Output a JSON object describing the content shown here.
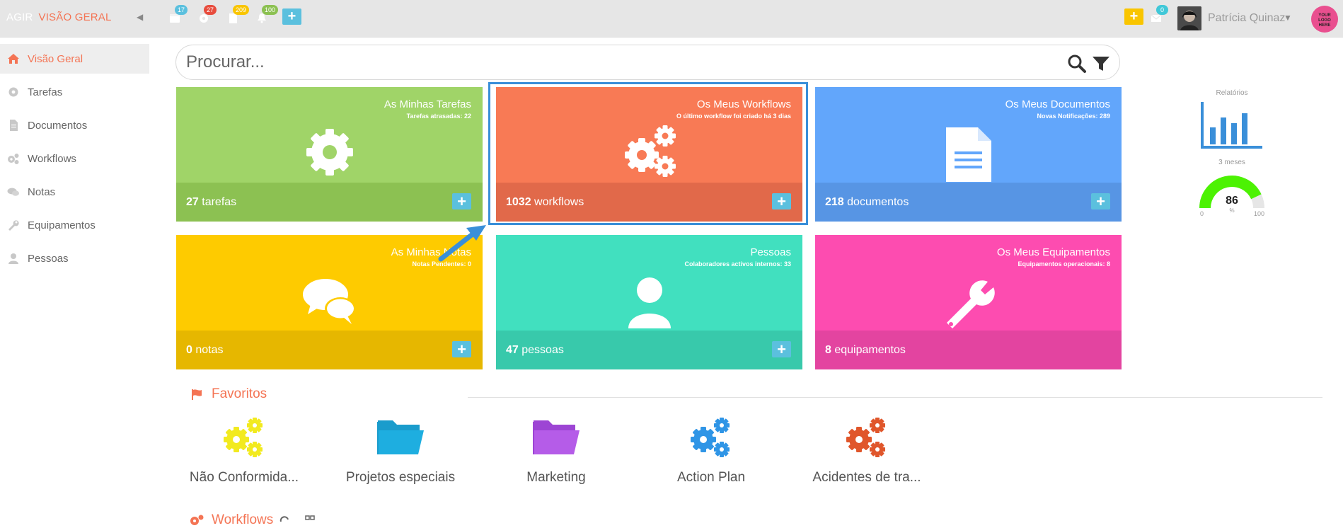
{
  "topbar": {
    "brand": "AGIR",
    "section": "VISÃO GERAL",
    "badges": {
      "calendar": "17",
      "gear": "27",
      "doc": "209",
      "bell": "100",
      "mail": "0"
    },
    "user_name": "Patrícia Quinaz",
    "logo_text_1": "YOUR",
    "logo_text_2": "LOGO",
    "logo_text_3": "HERE",
    "colors": {
      "badge_blue": "#5bc0de",
      "badge_red": "#e84c3d",
      "badge_yellow": "#f9c500",
      "badge_green": "#8cc152"
    }
  },
  "sidebar": {
    "items": [
      {
        "label": "Visão Geral",
        "icon": "home-icon",
        "active": true
      },
      {
        "label": "Tarefas",
        "icon": "gear-icon"
      },
      {
        "label": "Documentos",
        "icon": "document-icon"
      },
      {
        "label": "Workflows",
        "icon": "gears-icon"
      },
      {
        "label": "Notas",
        "icon": "comments-icon"
      },
      {
        "label": "Equipamentos",
        "icon": "wrench-icon"
      },
      {
        "label": "Pessoas",
        "icon": "user-icon"
      }
    ]
  },
  "search": {
    "placeholder": "Procurar..."
  },
  "tiles": [
    {
      "title": "As Minhas Tarefas",
      "sub": "Tarefas atrasadas: 22",
      "count": "27",
      "unit": "tarefas",
      "icon": "gear-icon",
      "color": "#a0d468",
      "footer_color": "#8cc152"
    },
    {
      "title": "Os Meus Workflows",
      "sub": "O último workflow foi criado há 3 dias",
      "count": "1032",
      "unit": "workflows",
      "icon": "gears-icon",
      "color": "#f87a55",
      "footer_color": "#e1694a"
    },
    {
      "title": "Os Meus Documentos",
      "sub": "Novas Notificações: 289",
      "count": "218",
      "unit": "documentos",
      "icon": "document-icon",
      "color": "#62a6fb",
      "footer_color": "#5795e4"
    },
    {
      "title": "As Minhas Notas",
      "sub": "Notas Pendentes: 0",
      "count": "0",
      "unit": "notas",
      "icon": "comments-icon",
      "color": "#fecb00",
      "footer_color": "#e6b700"
    },
    {
      "title": "Pessoas",
      "sub": "Colaboradores activos internos: 33",
      "count": "47",
      "unit": "pessoas",
      "icon": "user-icon",
      "color": "#41e0bf",
      "footer_color": "#38c9ab"
    },
    {
      "title": "Os Meus Equipamentos",
      "sub": "Equipamentos operacionais: 8",
      "count": "8",
      "unit": "equipamentos",
      "icon": "wrench-icon",
      "color": "#fd4cb0",
      "footer_color": "#e344a0"
    }
  ],
  "widgets": {
    "reports_title": "Relatórios",
    "period": "3 meses",
    "gauge_value": "86",
    "gauge_unit": "%",
    "gauge_min": "0",
    "gauge_max": "100",
    "gauge_fraction": 0.86
  },
  "favorites": {
    "title": "Favoritos",
    "items": [
      {
        "label": "Não Conformida...",
        "icon": "gears-icon",
        "color": "#f2ea1f"
      },
      {
        "label": "Projetos especiais",
        "icon": "folder-icon",
        "color": "#1eaee0"
      },
      {
        "label": "Marketing",
        "icon": "folder-icon",
        "color": "#b55ce8"
      },
      {
        "label": "Action Plan",
        "icon": "gears-icon",
        "color": "#2f95e6"
      },
      {
        "label": "Acidentes de tra...",
        "icon": "gears-icon",
        "color": "#e0562b"
      }
    ]
  },
  "workflows_section": {
    "title": "Workflows"
  }
}
